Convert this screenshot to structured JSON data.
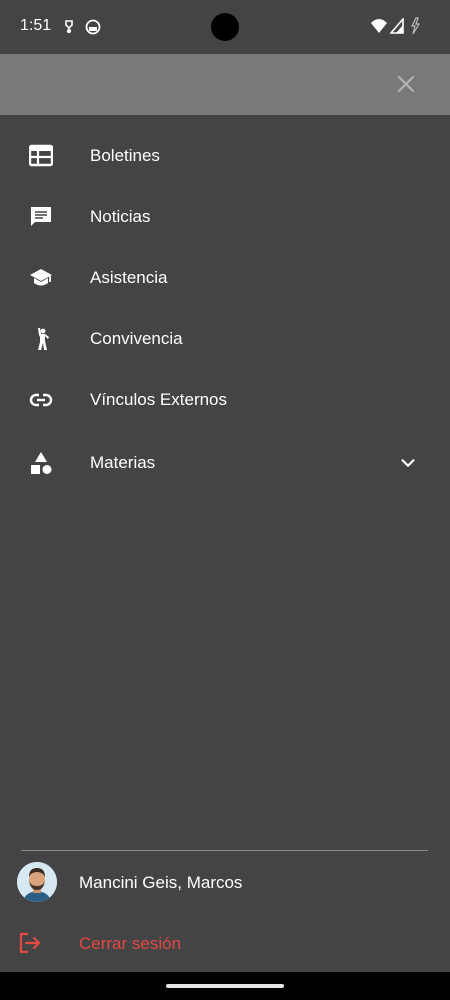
{
  "status_bar": {
    "time": "1:51"
  },
  "header": {
    "theme_icon": "moon-icon",
    "close_icon": "close-icon"
  },
  "menu": {
    "items": [
      {
        "label": "Boletines",
        "icon": "table-icon"
      },
      {
        "label": "Noticias",
        "icon": "chat-icon"
      },
      {
        "label": "Asistencia",
        "icon": "school-icon"
      },
      {
        "label": "Convivencia",
        "icon": "person-wave-icon"
      },
      {
        "label": "Vínculos Externos",
        "icon": "link-icon"
      },
      {
        "label": "Materias",
        "icon": "shapes-icon"
      }
    ]
  },
  "user": {
    "name": "Mancini Geis, Marcos"
  },
  "logout": {
    "label": "Cerrar sesión"
  },
  "colors": {
    "drawer_bg": "#444345",
    "header_bg": "#797979",
    "logout_red": "#e34a41"
  }
}
